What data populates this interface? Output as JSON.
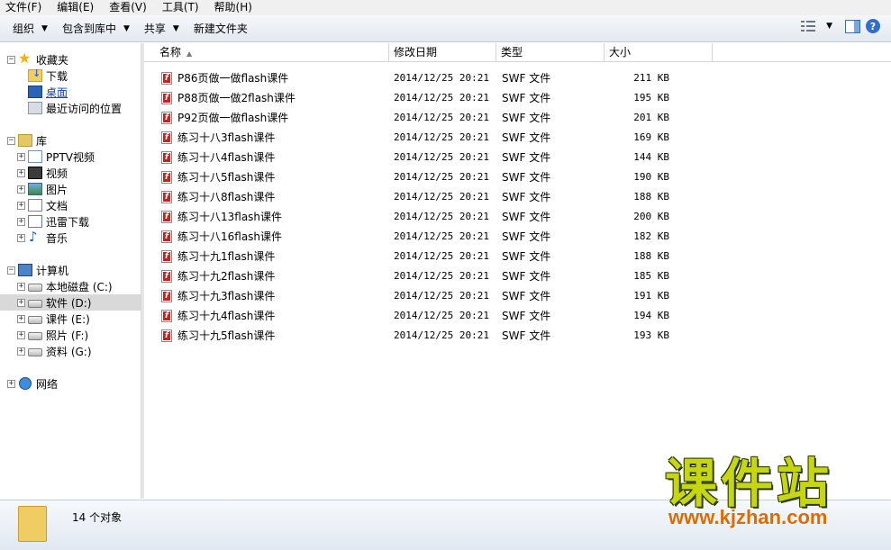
{
  "menubar": {
    "items": [
      "文件(F)",
      "编辑(E)",
      "查看(V)",
      "工具(T)",
      "帮助(H)"
    ]
  },
  "toolbar": {
    "organize": "组织",
    "include_in_library": "包含到库中",
    "share": "共享",
    "new_folder": "新建文件夹"
  },
  "nav": {
    "favorites": "收藏夹",
    "downloads": "下载",
    "desktop": "桌面",
    "recent": "最近访问的位置",
    "libraries": "库",
    "pptv": "PPTV视频",
    "videos": "视频",
    "pictures": "图片",
    "documents": "文档",
    "xunlei": "迅雷下载",
    "music": "音乐",
    "computer": "计算机",
    "drive_c": "本地磁盘 (C:)",
    "drive_d": "软件 (D:)",
    "drive_e": "课件 (E:)",
    "drive_f": "照片 (F:)",
    "drive_g": "资料 (G:)",
    "network": "网络"
  },
  "columns": {
    "name": "名称",
    "modified": "修改日期",
    "type": "类型",
    "size": "大小"
  },
  "files": [
    {
      "name": "P86页做一做flash课件",
      "date": "2014/12/25 20:21",
      "type": "SWF 文件",
      "size": "211 KB"
    },
    {
      "name": "P88页做一做2flash课件",
      "date": "2014/12/25 20:21",
      "type": "SWF 文件",
      "size": "195 KB"
    },
    {
      "name": "P92页做一做flash课件",
      "date": "2014/12/25 20:21",
      "type": "SWF 文件",
      "size": "201 KB"
    },
    {
      "name": "练习十八3flash课件",
      "date": "2014/12/25 20:21",
      "type": "SWF 文件",
      "size": "169 KB"
    },
    {
      "name": "练习十八4flash课件",
      "date": "2014/12/25 20:21",
      "type": "SWF 文件",
      "size": "144 KB"
    },
    {
      "name": "练习十八5flash课件",
      "date": "2014/12/25 20:21",
      "type": "SWF 文件",
      "size": "190 KB"
    },
    {
      "name": "练习十八8flash课件",
      "date": "2014/12/25 20:21",
      "type": "SWF 文件",
      "size": "188 KB"
    },
    {
      "name": "练习十八13flash课件",
      "date": "2014/12/25 20:21",
      "type": "SWF 文件",
      "size": "200 KB"
    },
    {
      "name": "练习十八16flash课件",
      "date": "2014/12/25 20:21",
      "type": "SWF 文件",
      "size": "182 KB"
    },
    {
      "name": "练习十九1flash课件",
      "date": "2014/12/25 20:21",
      "type": "SWF 文件",
      "size": "188 KB"
    },
    {
      "name": "练习十九2flash课件",
      "date": "2014/12/25 20:21",
      "type": "SWF 文件",
      "size": "185 KB"
    },
    {
      "name": "练习十九3flash课件",
      "date": "2014/12/25 20:21",
      "type": "SWF 文件",
      "size": "191 KB"
    },
    {
      "name": "练习十九4flash课件",
      "date": "2014/12/25 20:21",
      "type": "SWF 文件",
      "size": "194 KB"
    },
    {
      "name": "练习十九5flash课件",
      "date": "2014/12/25 20:21",
      "type": "SWF 文件",
      "size": "193 KB"
    }
  ],
  "status": {
    "count_text": "14 个对象"
  },
  "watermark": {
    "title": "课件站",
    "url": "www.kjzhan.com"
  },
  "icons": {
    "file": "swf-file-icon",
    "view": "view-options-icon",
    "preview": "preview-pane-icon",
    "help": "help-icon"
  }
}
